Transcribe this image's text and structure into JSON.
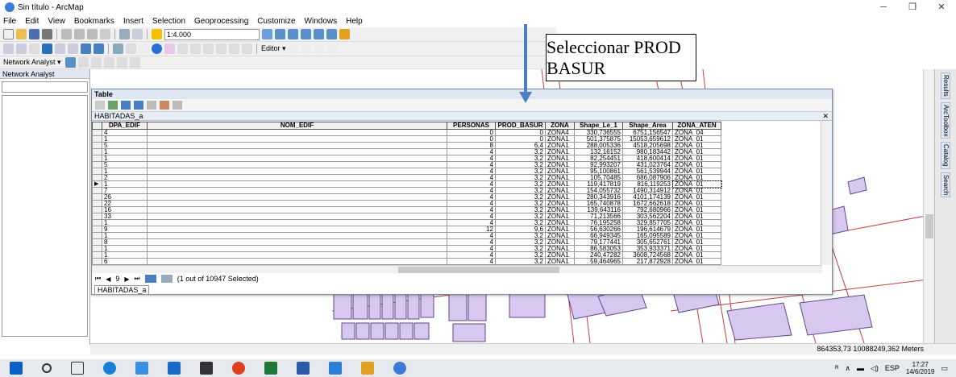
{
  "window": {
    "title": "Sin título - ArcMap"
  },
  "menu": [
    "File",
    "Edit",
    "View",
    "Bookmarks",
    "Insert",
    "Selection",
    "Geoprocessing",
    "Customize",
    "Windows",
    "Help"
  ],
  "toolbar": {
    "scale": "1:4.000",
    "editor_label": "Editor ▾",
    "network_analyst_label": "Network Analyst ▾"
  },
  "left_panel": {
    "title": "Network Analyst"
  },
  "table_window": {
    "title": "Table",
    "tab_name": "HABITADAS_a",
    "columns": [
      "DPA_EDIF",
      "NOM_EDIF",
      "PERSONAS",
      "PROD_BASUR",
      "ZONA",
      "Shape_Le_1",
      "Shape_Area",
      "ZONA_ATEN"
    ],
    "rows": [
      [
        "4",
        "",
        "0",
        "0",
        "ZONA4",
        "330,736555",
        "6751,156547",
        "ZONA_04"
      ],
      [
        "1",
        "",
        "0",
        "0",
        "ZONA1",
        "501,375875",
        "15053,659612",
        "ZONA_01"
      ],
      [
        "5",
        "",
        "8",
        "6,4",
        "ZONA1",
        "288,005336",
        "4518,205698",
        "ZONA_01"
      ],
      [
        "1",
        "",
        "4",
        "3,2",
        "ZONA1",
        "132,16152",
        "980,183442",
        "ZONA_01"
      ],
      [
        "1",
        "",
        "4",
        "3,2",
        "ZONA1",
        "82,254451",
        "418,600414",
        "ZONA_01"
      ],
      [
        "5",
        "",
        "4",
        "3,2",
        "ZONA1",
        "92,993207",
        "431,023764",
        "ZONA_01"
      ],
      [
        "1",
        "",
        "4",
        "3,2",
        "ZONA1",
        "95,100861",
        "561,539944",
        "ZONA_01"
      ],
      [
        "2",
        "",
        "4",
        "3,2",
        "ZONA1",
        "105,70485",
        "686,087906",
        "ZONA_01"
      ],
      [
        "1",
        "",
        "4",
        "3,2",
        "ZONA1",
        "119,417819",
        "816,119253",
        "ZONA_01"
      ],
      [
        "7",
        "",
        "4",
        "3,2",
        "ZONA1",
        "154,055732",
        "1490,314912",
        "ZONA_01"
      ],
      [
        "26",
        "",
        "4",
        "3,2",
        "ZONA1",
        "280,343916",
        "4101,174139",
        "ZONA_01"
      ],
      [
        "22",
        "",
        "4",
        "3,2",
        "ZONA1",
        "165,740878",
        "1672,662618",
        "ZONA_01"
      ],
      [
        "16",
        "",
        "4",
        "3,2",
        "ZONA1",
        "139,643116",
        "792,680966",
        "ZONA_01"
      ],
      [
        "33",
        "",
        "4",
        "3,2",
        "ZONA1",
        "71,213566",
        "303,562204",
        "ZONA_01"
      ],
      [
        "1",
        "",
        "4",
        "3,2",
        "ZONA1",
        "76,195258",
        "329,857705",
        "ZONA_01"
      ],
      [
        "9",
        "",
        "12",
        "9,6",
        "ZONA1",
        "56,630266",
        "196,614679",
        "ZONA_01"
      ],
      [
        "1",
        "",
        "4",
        "3,2",
        "ZONA1",
        "66,949345",
        "165,095589",
        "ZONA_01"
      ],
      [
        "8",
        "",
        "4",
        "3,2",
        "ZONA1",
        "79,177441",
        "305,652761",
        "ZONA_01"
      ],
      [
        "1",
        "",
        "4",
        "3,2",
        "ZONA1",
        "86,583053",
        "353,933371",
        "ZONA_01"
      ],
      [
        "1",
        "",
        "4",
        "3,2",
        "ZONA1",
        "240,47282",
        "3608,724568",
        "ZONA_01"
      ],
      [
        "6",
        "",
        "4",
        "3,2",
        "ZONA1",
        "59,464965",
        "217,872928",
        "ZONA_01"
      ]
    ],
    "current_row_index": 8,
    "record_number": "9",
    "selection_info": "(1 out of 10947 Selected)"
  },
  "callout": {
    "text": "Seleccionar PROD BASUR"
  },
  "status": {
    "coordinates": "864353,73 10088249,362 Meters"
  },
  "dock": [
    "Results",
    "ArcToolbox",
    "Catalog",
    "Search"
  ],
  "taskbar": {
    "language": "ESP",
    "time": "17:27",
    "date": "14/6/2019"
  },
  "colors": {
    "parcel_fill": "#d8c8f0",
    "parcel_stroke": "#5a4a8a",
    "road": "#c04040",
    "arrow": "#4a7fc1"
  }
}
